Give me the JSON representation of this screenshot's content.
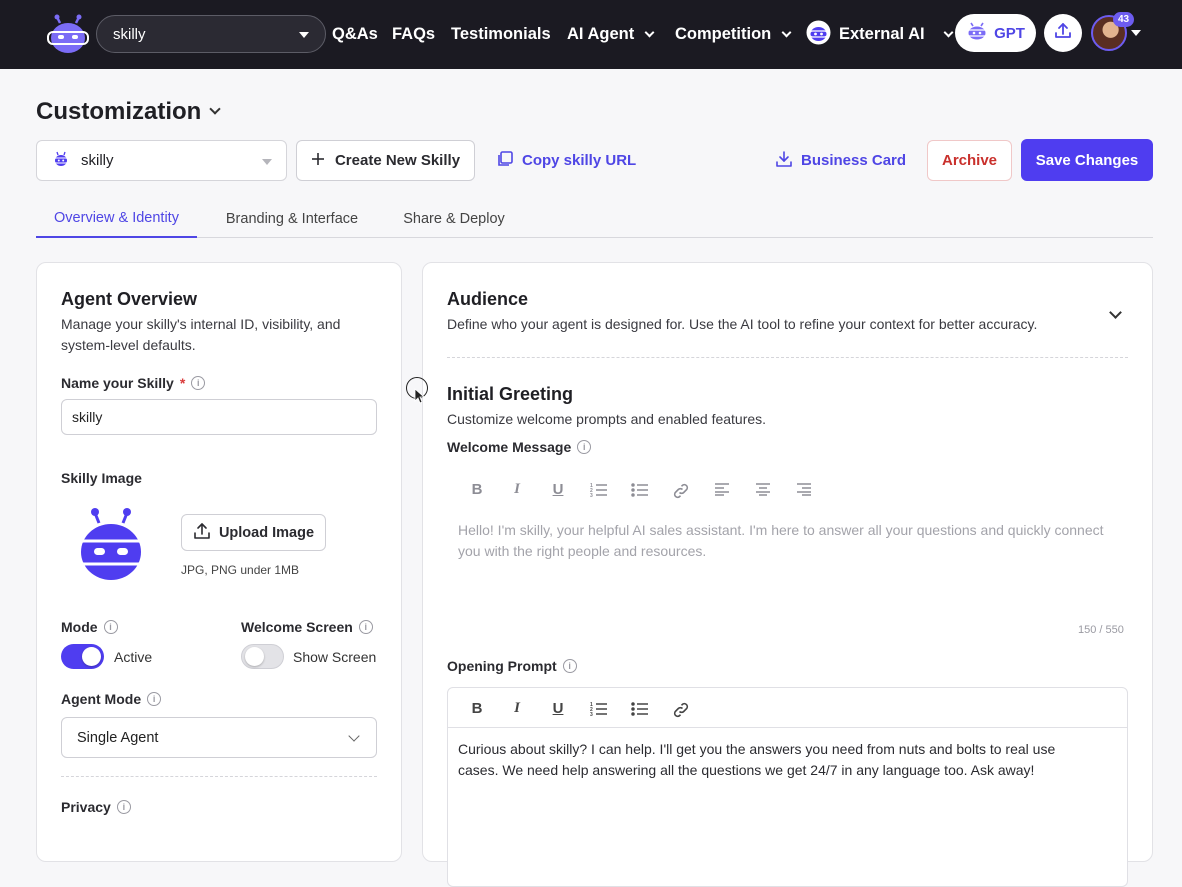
{
  "topbar": {
    "skilly_select": "skilly",
    "nav": {
      "qas": "Q&As",
      "faqs": "FAQs",
      "testimonials": "Testimonials",
      "ai_agent": "AI Agent",
      "competition": "Competition",
      "external_ai": "External AI"
    },
    "gpt_label": "GPT",
    "notification_count": "43"
  },
  "page": {
    "title": "Customization"
  },
  "actions": {
    "skilly_dropdown": "skilly",
    "create_new": "Create New Skilly",
    "copy_url": "Copy skilly URL",
    "business_card": "Business Card",
    "archive": "Archive",
    "save": "Save Changes"
  },
  "tabs": {
    "overview": "Overview & Identity",
    "branding": "Branding & Interface",
    "share": "Share & Deploy",
    "active": "Overview & Identity"
  },
  "agent_overview": {
    "title": "Agent Overview",
    "description": "Manage your skilly's internal ID, visibility, and system-level defaults.",
    "name_label": "Name your Skilly",
    "required_mark": "*",
    "name_value": "skilly",
    "image_label": "Skilly Image",
    "upload_label": "Upload Image",
    "upload_hint": "JPG, PNG under 1MB",
    "mode_label": "Mode",
    "mode_value": "Active",
    "mode_on": true,
    "welcome_screen_label": "Welcome Screen",
    "welcome_screen_value": "Show Screen",
    "welcome_screen_on": false,
    "agent_mode_label": "Agent Mode",
    "agent_mode_value": "Single Agent",
    "privacy_label": "Privacy"
  },
  "audience": {
    "title": "Audience",
    "description": "Define who your agent is designed for. Use the AI tool to refine your context for better accuracy."
  },
  "initial_greeting": {
    "title": "Initial Greeting",
    "description": "Customize welcome prompts and enabled features.",
    "welcome_label": "Welcome Message",
    "welcome_placeholder": "Hello! I'm skilly, your helpful AI sales assistant. I'm here to answer all your questions and quickly connect you with the right people and resources.",
    "char_count": "150 / 550",
    "opening_label": "Opening Prompt",
    "opening_value": "Curious about skilly? I can help. I'll get you the answers you need from nuts and bolts to real use cases. We need help answering all the questions we get 24/7 in any language too. Ask away!"
  },
  "colors": {
    "accent": "#4f3df0",
    "topbar": "#1b1a22",
    "archive": "#c9302c"
  }
}
